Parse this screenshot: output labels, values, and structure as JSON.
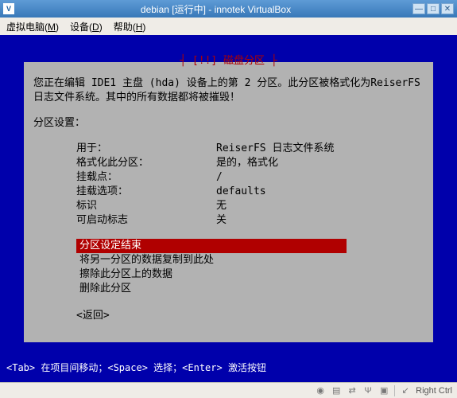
{
  "window": {
    "title": "debian [运行中] - innotek VirtualBox",
    "icon_glyph": "V"
  },
  "menubar": {
    "vm": "虚拟电脑",
    "vm_accel": "M",
    "devices": "设备",
    "devices_accel": "D",
    "help": "帮助",
    "help_accel": "H"
  },
  "tui": {
    "title": "[!!] 磁盘分区",
    "intro": "您正在编辑 IDE1 主盘 (hda) 设备上的第 2 分区。此分区被格式化为ReiserFS 日志文件系统。其中的所有数据都将被摧毁！",
    "settings_label": "分区设置：",
    "settings": [
      {
        "key": "用于：",
        "value": "ReiserFS 日志文件系统"
      },
      {
        "key": "格式化此分区：",
        "value": "是的，格式化"
      },
      {
        "key": "挂载点：",
        "value": "/"
      },
      {
        "key": "挂载选项：",
        "value": "defaults"
      },
      {
        "key": "标识",
        "value": "无"
      },
      {
        "key": "可启动标志",
        "value": "关"
      }
    ],
    "actions": [
      {
        "label": "分区设定结束",
        "selected": true
      },
      {
        "label": "将另一分区的数据复制到此处",
        "selected": false
      },
      {
        "label": "擦除此分区上的数据",
        "selected": false
      },
      {
        "label": "删除此分区",
        "selected": false
      }
    ],
    "return_label": "<返回>",
    "footer_hint": "<Tab> 在项目间移动；<Space> 选择；<Enter> 激活按钮"
  },
  "statusbar": {
    "host_key": "Right Ctrl"
  }
}
